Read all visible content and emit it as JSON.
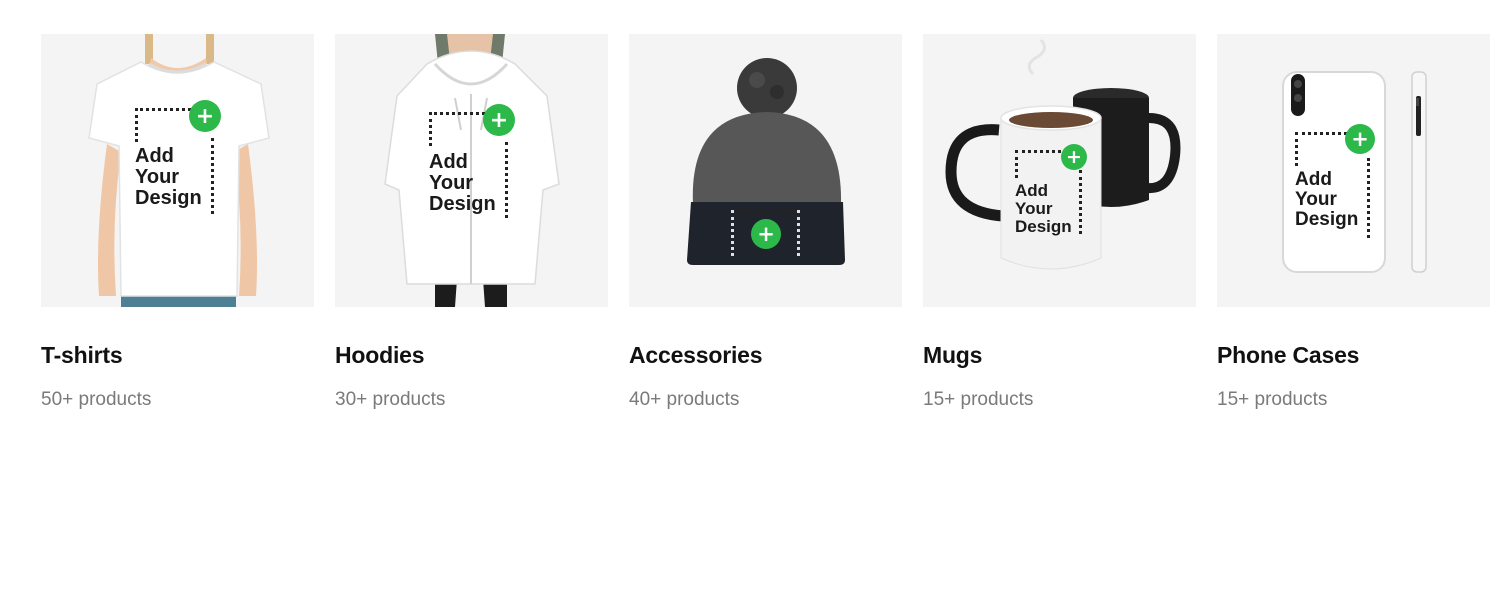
{
  "design_prompt": "Add\nYour\nDesign",
  "plus_symbol": "+",
  "accent_color": "#2db84a",
  "categories": [
    {
      "title": "T-shirts",
      "count": "50+ products",
      "icon": "tshirt-image"
    },
    {
      "title": "Hoodies",
      "count": "30+ products",
      "icon": "hoodie-image"
    },
    {
      "title": "Accessories",
      "count": "40+ products",
      "icon": "beanie-image"
    },
    {
      "title": "Mugs",
      "count": "15+ products",
      "icon": "mug-image"
    },
    {
      "title": "Phone Cases",
      "count": "15+ products",
      "icon": "phone-case-image"
    }
  ]
}
